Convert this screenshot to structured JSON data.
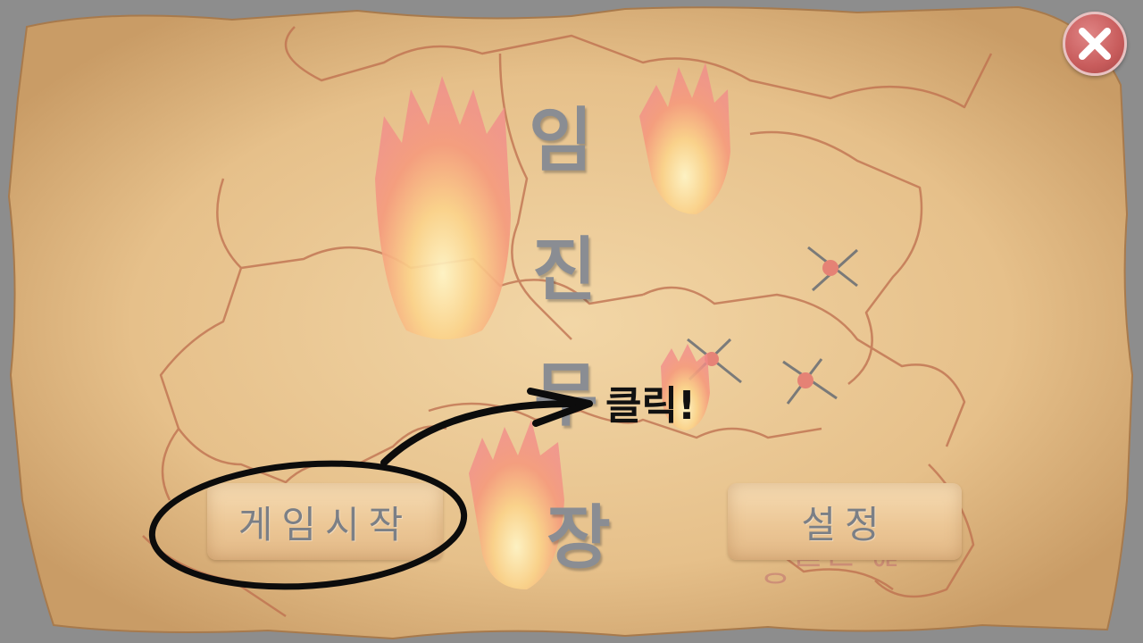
{
  "title": {
    "chars": [
      "임",
      "진",
      "무",
      "장"
    ]
  },
  "hint": {
    "text": "클릭!"
  },
  "buttons": {
    "start_label": "게임시작",
    "settings_label": "설정"
  },
  "icons": {
    "close": "close-x-icon",
    "flame": "flame-icon",
    "battle_marker": "crossed-swords-marker-icon"
  },
  "colors": {
    "parchment": "#e9c794",
    "map_lines": "#b9603f",
    "title_ink": "#8a8d93",
    "close_button": "#c85c5c",
    "background": "#8d8d8d"
  }
}
